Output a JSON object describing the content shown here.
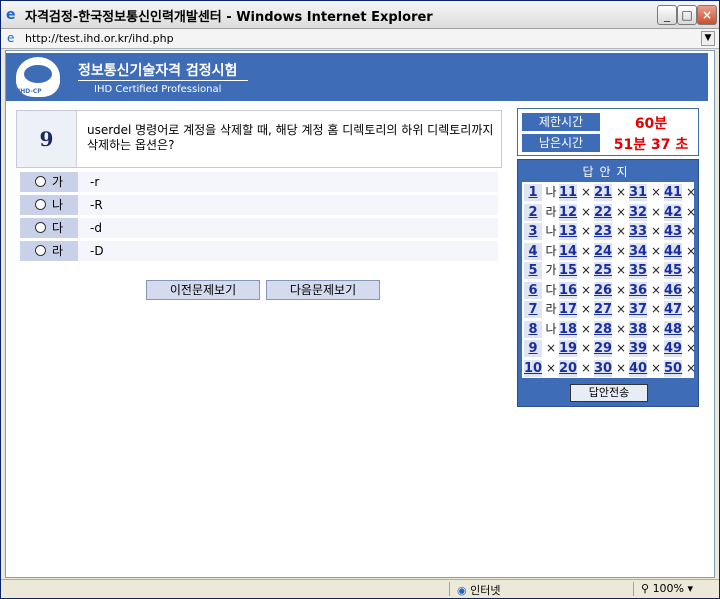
{
  "window": {
    "title": "자격검정-한국정보통신인력개발센터 - Windows Internet Explorer",
    "address": "http://test.ihd.or.kr/ihd.php"
  },
  "header": {
    "logo_text": "IHD-CP",
    "title": "정보통신기술자격  검정시험",
    "subtitle": "IHD Certified Professional"
  },
  "question": {
    "number": "9",
    "text": "userdel 명령어로 계정을 삭제할 때, 해당 계정 홈 디렉토리의 하위 디렉토리까지 삭제하는 옵션은?"
  },
  "options": [
    {
      "label": "가",
      "value": "-r"
    },
    {
      "label": "나",
      "value": "-R"
    },
    {
      "label": "다",
      "value": "-d"
    },
    {
      "label": "라",
      "value": "-D"
    }
  ],
  "nav": {
    "prev_label": "이전문제보기",
    "next_label": "다음문제보기"
  },
  "timer": {
    "limit_label": "제한시간",
    "limit_value": "60분",
    "remain_label": "남은시간",
    "remain_value": "51분 37 초"
  },
  "answer_sheet": {
    "title": "답안지",
    "submit_label": "답안전송",
    "columns": [
      [
        {
          "n": "1",
          "m": "나"
        },
        {
          "n": "2",
          "m": "라"
        },
        {
          "n": "3",
          "m": "나"
        },
        {
          "n": "4",
          "m": "다"
        },
        {
          "n": "5",
          "m": "가"
        },
        {
          "n": "6",
          "m": "다"
        },
        {
          "n": "7",
          "m": "라"
        },
        {
          "n": "8",
          "m": "나"
        },
        {
          "n": "9",
          "m": "×"
        },
        {
          "n": "10",
          "m": "×"
        }
      ],
      [
        {
          "n": "11",
          "m": "×"
        },
        {
          "n": "12",
          "m": "×"
        },
        {
          "n": "13",
          "m": "×"
        },
        {
          "n": "14",
          "m": "×"
        },
        {
          "n": "15",
          "m": "×"
        },
        {
          "n": "16",
          "m": "×"
        },
        {
          "n": "17",
          "m": "×"
        },
        {
          "n": "18",
          "m": "×"
        },
        {
          "n": "19",
          "m": "×"
        },
        {
          "n": "20",
          "m": "×"
        }
      ],
      [
        {
          "n": "21",
          "m": "×"
        },
        {
          "n": "22",
          "m": "×"
        },
        {
          "n": "23",
          "m": "×"
        },
        {
          "n": "24",
          "m": "×"
        },
        {
          "n": "25",
          "m": "×"
        },
        {
          "n": "26",
          "m": "×"
        },
        {
          "n": "27",
          "m": "×"
        },
        {
          "n": "28",
          "m": "×"
        },
        {
          "n": "29",
          "m": "×"
        },
        {
          "n": "30",
          "m": "×"
        }
      ],
      [
        {
          "n": "31",
          "m": "×"
        },
        {
          "n": "32",
          "m": "×"
        },
        {
          "n": "33",
          "m": "×"
        },
        {
          "n": "34",
          "m": "×"
        },
        {
          "n": "35",
          "m": "×"
        },
        {
          "n": "36",
          "m": "×"
        },
        {
          "n": "37",
          "m": "×"
        },
        {
          "n": "38",
          "m": "×"
        },
        {
          "n": "39",
          "m": "×"
        },
        {
          "n": "40",
          "m": "×"
        }
      ],
      [
        {
          "n": "41",
          "m": "×"
        },
        {
          "n": "42",
          "m": "×"
        },
        {
          "n": "43",
          "m": "×"
        },
        {
          "n": "44",
          "m": "×"
        },
        {
          "n": "45",
          "m": "×"
        },
        {
          "n": "46",
          "m": "×"
        },
        {
          "n": "47",
          "m": "×"
        },
        {
          "n": "48",
          "m": "×"
        },
        {
          "n": "49",
          "m": "×"
        },
        {
          "n": "50",
          "m": "×"
        }
      ]
    ]
  },
  "status": {
    "zone": "인터넷",
    "zoom": "100%"
  },
  "colors": {
    "brand_blue": "#3e6cb7",
    "time_red": "#e00000"
  }
}
